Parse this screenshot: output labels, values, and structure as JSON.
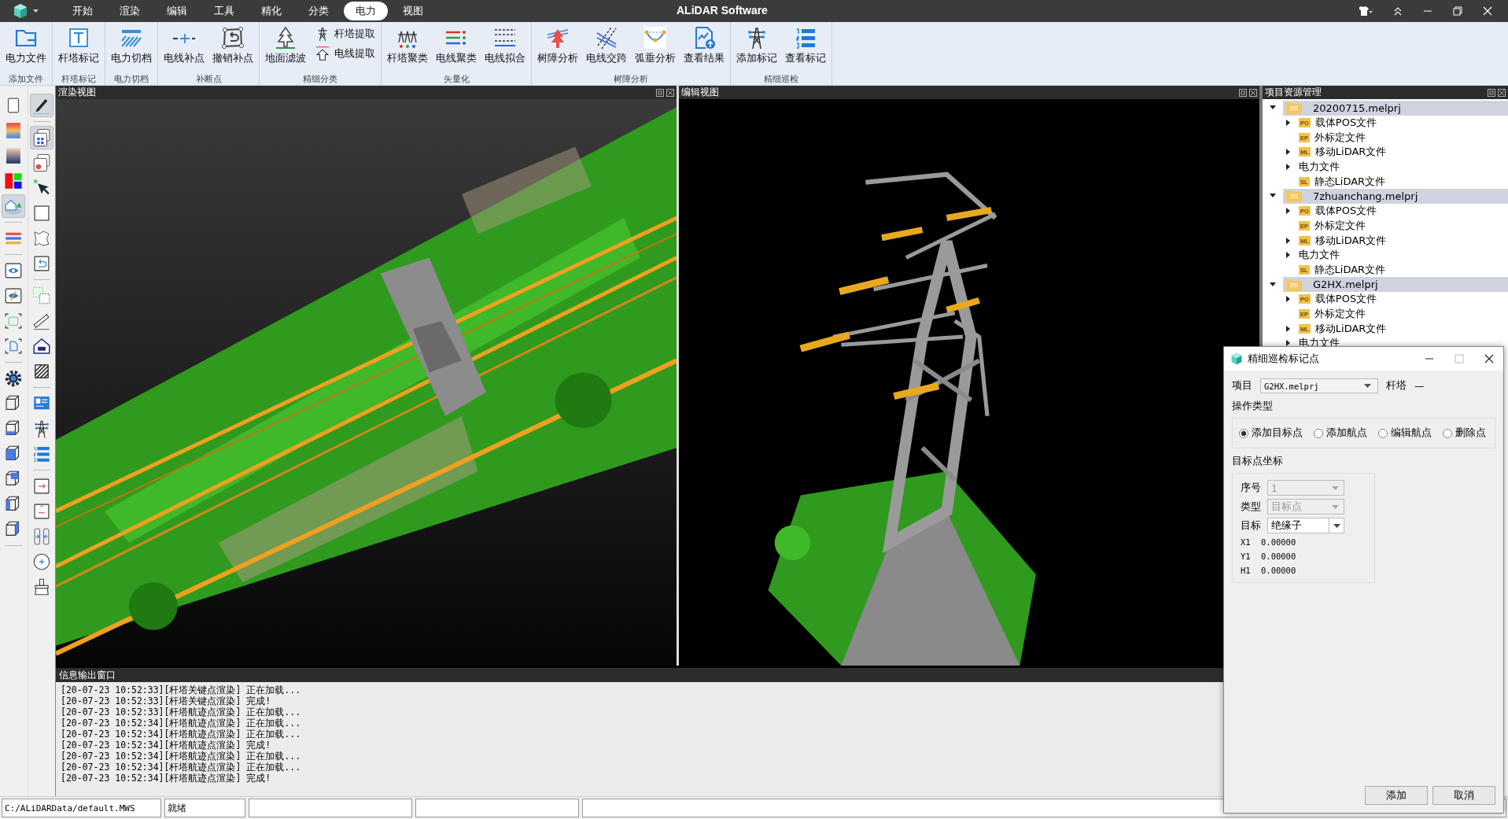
{
  "app": {
    "title": "ALiDAR Software"
  },
  "menu_tabs": [
    {
      "label": "开始",
      "selected": false
    },
    {
      "label": "渲染",
      "selected": false
    },
    {
      "label": "编辑",
      "selected": false
    },
    {
      "label": "工具",
      "selected": false
    },
    {
      "label": "精化",
      "selected": false
    },
    {
      "label": "分类",
      "selected": false
    },
    {
      "label": "电力",
      "selected": true
    },
    {
      "label": "视图",
      "selected": false
    }
  ],
  "ribbon_groups": [
    {
      "label": "添加文件",
      "buttons": [
        {
          "label": "电力文件",
          "kind": "large"
        }
      ]
    },
    {
      "label": "杆塔标记",
      "buttons": [
        {
          "label": "杆塔标记",
          "kind": "large"
        }
      ]
    },
    {
      "label": "电力切档",
      "buttons": [
        {
          "label": "电力切档",
          "kind": "large"
        }
      ]
    },
    {
      "label": "补断点",
      "buttons": [
        {
          "label": "电线补点",
          "kind": "large"
        },
        {
          "label": "撤销补点",
          "kind": "large"
        }
      ]
    },
    {
      "label": "精细分类",
      "buttons": [
        {
          "label": "地面滤波",
          "kind": "large"
        },
        {
          "label": "杆塔提取",
          "kind": "small"
        },
        {
          "label": "电线提取",
          "kind": "small"
        }
      ]
    },
    {
      "label": "矢量化",
      "buttons": [
        {
          "label": "杆塔聚类",
          "kind": "large"
        },
        {
          "label": "电线聚类",
          "kind": "large"
        },
        {
          "label": "电线拟合",
          "kind": "large"
        }
      ]
    },
    {
      "label": "树障分析",
      "buttons": [
        {
          "label": "树障分析",
          "kind": "large"
        },
        {
          "label": "电线交跨",
          "kind": "large"
        },
        {
          "label": "弧垂分析",
          "kind": "large"
        },
        {
          "label": "查看结果",
          "kind": "large"
        }
      ]
    },
    {
      "label": "精细巡检",
      "buttons": [
        {
          "label": "添加标记",
          "kind": "large"
        },
        {
          "label": "查看标记",
          "kind": "large"
        }
      ]
    }
  ],
  "tool_columns": [
    [
      {
        "selected": false
      },
      {
        "selected": false
      },
      {
        "selected": false
      },
      {
        "selected": false
      },
      {
        "selected": true
      },
      {
        "selected": false
      },
      {
        "selected": false
      },
      {
        "selected": false
      },
      {
        "selected": false
      },
      {
        "selected": false
      },
      {
        "selected": false
      },
      {
        "selected": false
      },
      {
        "selected": false
      },
      {
        "selected": false
      },
      {
        "selected": false
      },
      {
        "selected": false
      },
      {
        "selected": false
      }
    ],
    [
      {
        "selected": true
      },
      {
        "selected": true
      },
      {
        "selected": false
      },
      {
        "selected": false
      },
      {
        "selected": false
      },
      {
        "selected": false
      },
      {
        "selected": false
      },
      {
        "selected": false
      },
      {
        "selected": false
      },
      {
        "selected": false
      },
      {
        "selected": false
      },
      {
        "selected": false
      },
      {
        "selected": false
      },
      {
        "selected": false
      },
      {
        "selected": false
      },
      {
        "selected": false
      },
      {
        "selected": false
      },
      {
        "selected": false
      },
      {
        "selected": false
      }
    ]
  ],
  "views": [
    {
      "title": "渲染视图",
      "kind": "corridor"
    },
    {
      "title": "编辑视图",
      "kind": "tower"
    }
  ],
  "project_panel": {
    "title": "项目资源管理",
    "projects": [
      {
        "label": "20200715.melprj",
        "expanded": true,
        "children": [
          {
            "label": "载体POS文件",
            "badge": "PO",
            "expandable": true
          },
          {
            "label": "外标定文件",
            "badge": "EP",
            "expandable": false
          },
          {
            "label": "移动LiDAR文件",
            "badge": "ML",
            "expandable": true
          },
          {
            "label": "电力文件",
            "expandable": true
          },
          {
            "label": "静态LiDAR文件",
            "badge": "SL",
            "expandable": false
          }
        ]
      },
      {
        "label": "7zhuanchang.melprj",
        "expanded": true,
        "children": [
          {
            "label": "载体POS文件",
            "badge": "PO",
            "expandable": true
          },
          {
            "label": "外标定文件",
            "badge": "EP",
            "expandable": false
          },
          {
            "label": "移动LiDAR文件",
            "badge": "ML",
            "expandable": true
          },
          {
            "label": "电力文件",
            "expandable": true
          },
          {
            "label": "静态LiDAR文件",
            "badge": "SL",
            "expandable": false
          }
        ]
      },
      {
        "label": "G2HX.melprj",
        "expanded": true,
        "children": [
          {
            "label": "载体POS文件",
            "badge": "PO",
            "expandable": true
          },
          {
            "label": "外标定文件",
            "badge": "EP",
            "expandable": false
          },
          {
            "label": "移动LiDAR文件",
            "badge": "ML",
            "expandable": true
          },
          {
            "label": "电力文件",
            "expandable": true
          }
        ]
      }
    ]
  },
  "log": {
    "title": "信息输出窗口",
    "lines": [
      "[20-07-23 10:52:33][杆塔关键点渲染] 正在加载...",
      "[20-07-23 10:52:33][杆塔关键点渲染] 完成!",
      "[20-07-23 10:52:33][杆塔航迹点渲染] 正在加载...",
      "[20-07-23 10:52:34][杆塔航迹点渲染] 正在加载...",
      "[20-07-23 10:52:34][杆塔航迹点渲染] 正在加载...",
      "[20-07-23 10:52:34][杆塔航迹点渲染] 完成!",
      "[20-07-23 10:52:34][杆塔航迹点渲染] 正在加载...",
      "[20-07-23 10:52:34][杆塔航迹点渲染] 正在加载...",
      "[20-07-23 10:52:34][杆塔航迹点渲染] 完成!"
    ]
  },
  "status_bar": {
    "path": "C:/ALiDARData/default.MWS",
    "state": "就绪"
  },
  "dialog": {
    "title": "精细巡检标记点",
    "project_label": "项目",
    "project_value": "G2HX.melprj",
    "tower_label": "杆塔",
    "tower_value": "—",
    "operation_label": "操作类型",
    "options": [
      {
        "label": "添加目标点",
        "selected": true
      },
      {
        "label": "添加航点",
        "selected": false
      },
      {
        "label": "编辑航点",
        "selected": false
      },
      {
        "label": "删除点",
        "selected": false
      }
    ],
    "coords_label": "目标点坐标",
    "fields": [
      {
        "label": "序号",
        "value": "1",
        "disabled": true
      },
      {
        "label": "类型",
        "value": "目标点",
        "disabled": true
      },
      {
        "label": "目标",
        "value": "绝缘子",
        "disabled": false
      }
    ],
    "coords": [
      {
        "label": "X1",
        "value": "0.00000"
      },
      {
        "label": "Y1",
        "value": "0.00000"
      },
      {
        "label": "H1",
        "value": "0.00000"
      }
    ],
    "buttons": [
      "添加",
      "取消"
    ]
  }
}
